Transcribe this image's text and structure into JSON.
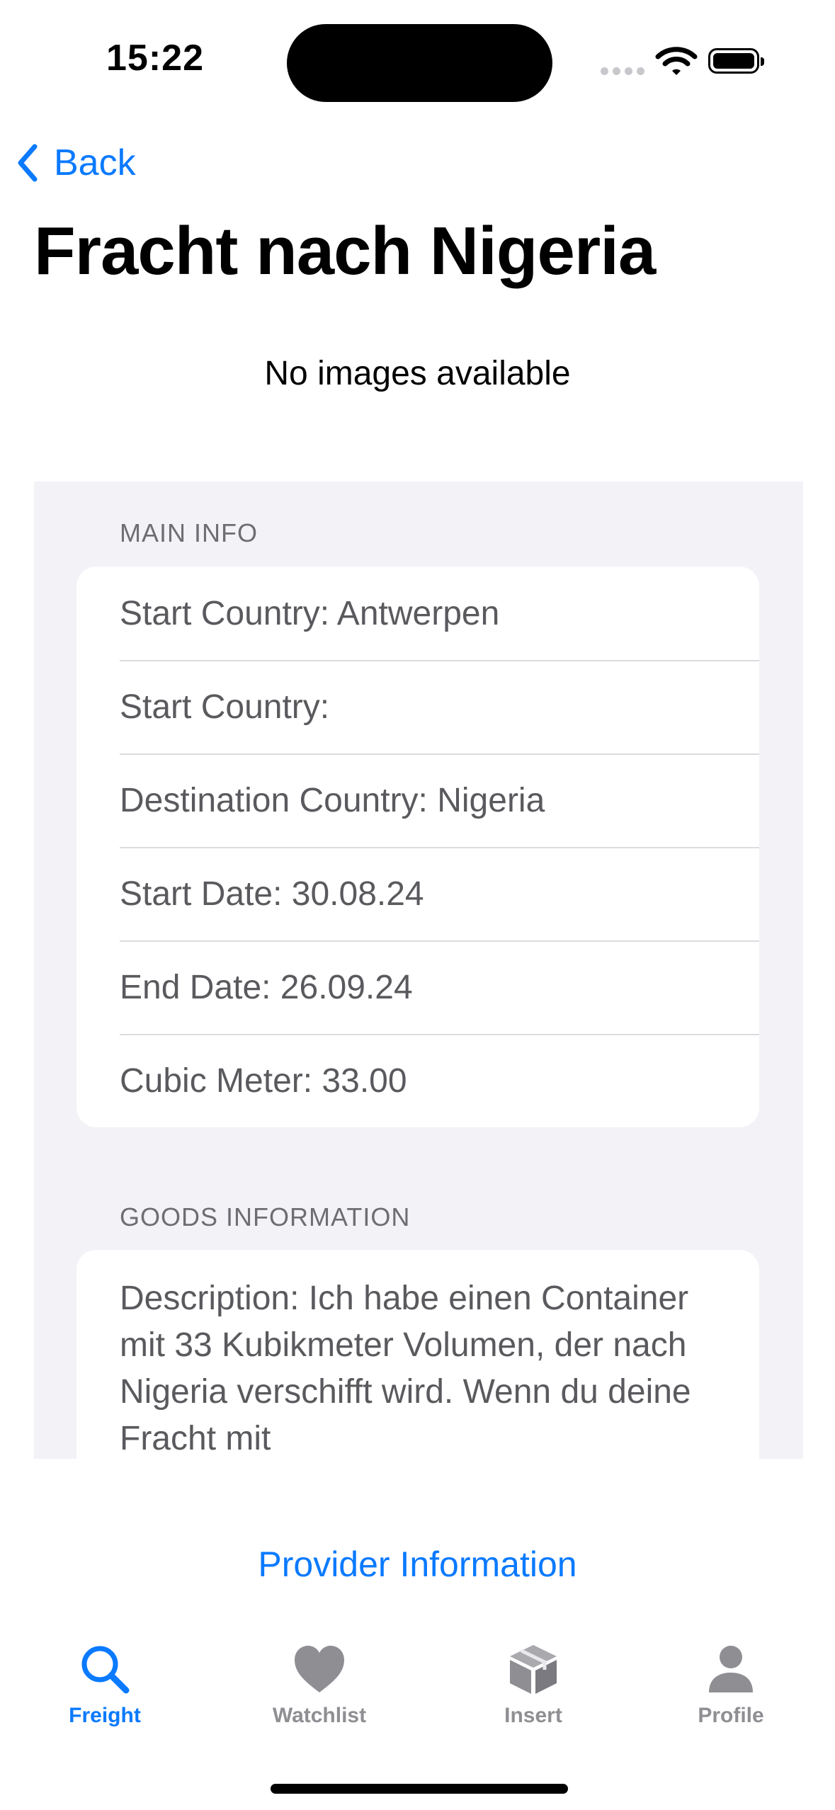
{
  "status_bar": {
    "time": "15:22"
  },
  "nav": {
    "back_label": "Back",
    "title": "Fracht nach Nigeria"
  },
  "images": {
    "empty_text": "No images available"
  },
  "main_info": {
    "header": "MAIN INFO",
    "rows": [
      "Start Country: Antwerpen",
      "Start Country:",
      "Destination Country: Nigeria",
      "Start Date: 30.08.24",
      "End Date: 26.09.24",
      "Cubic Meter: 33.00"
    ]
  },
  "goods_information": {
    "header": "GOODS INFORMATION",
    "description": "Description: Ich habe einen Container mit 33 Kubikmeter Volumen, der nach Nigeria verschifft wird. Wenn du deine Fracht mit"
  },
  "provider_link": "Provider Information",
  "tab_bar": {
    "tabs": [
      {
        "label": "Freight",
        "icon": "search-icon",
        "active": true
      },
      {
        "label": "Watchlist",
        "icon": "heart-icon",
        "active": false
      },
      {
        "label": "Insert",
        "icon": "package-icon",
        "active": false
      },
      {
        "label": "Profile",
        "icon": "person-icon",
        "active": false
      }
    ]
  },
  "colors": {
    "accent": "#0a7aff",
    "inactive": "#8e8e93",
    "grouped_background": "#f2f2f7"
  }
}
